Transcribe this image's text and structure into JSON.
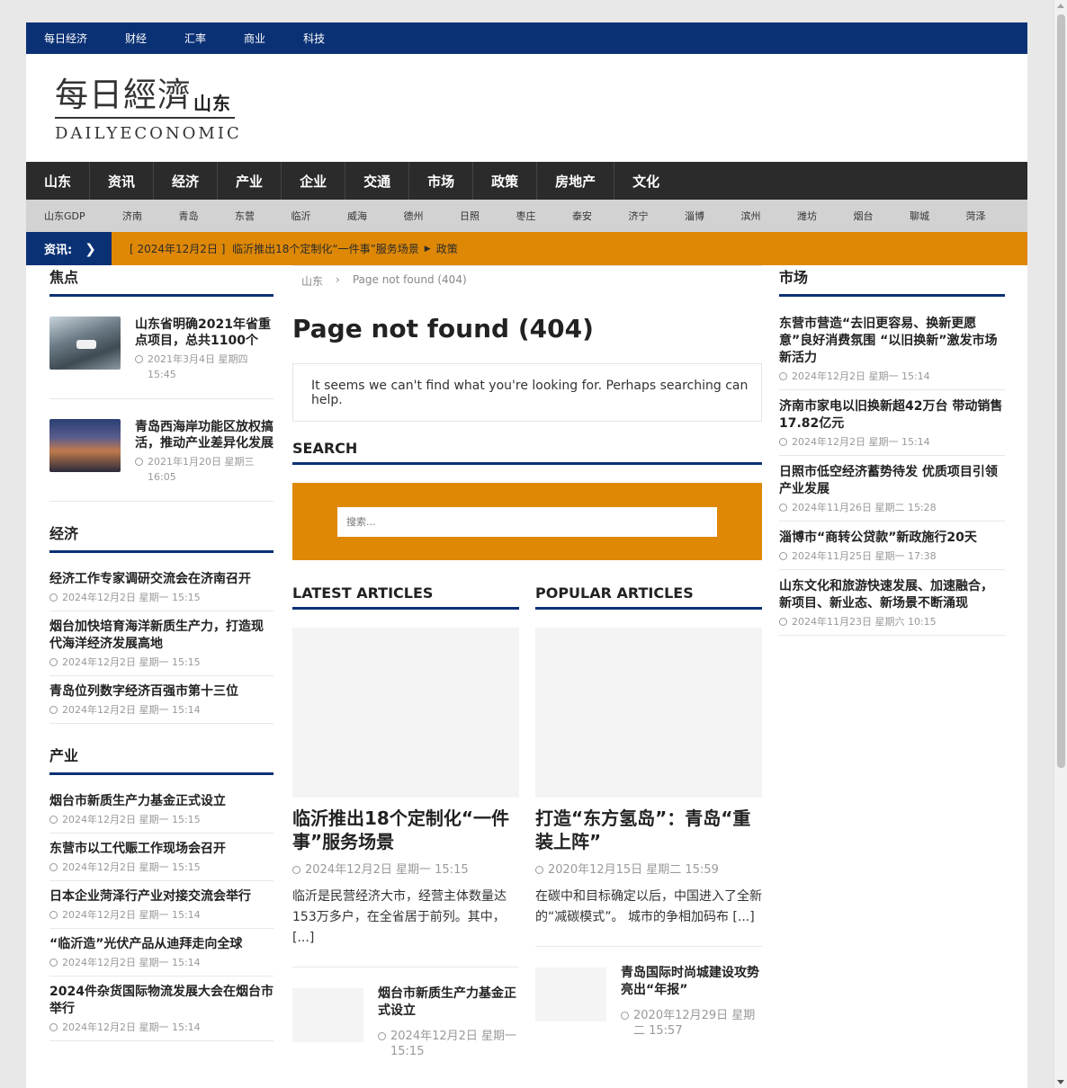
{
  "topbar": {
    "links": [
      "每日经济",
      "财经",
      "汇率",
      "商业",
      "科技"
    ]
  },
  "logo": {
    "cn": "每日經濟",
    "sub": "山东",
    "en": "DAILYECONOMIC"
  },
  "mainnav": [
    "山东",
    "资讯",
    "经济",
    "产业",
    "企业",
    "交通",
    "市场",
    "政策",
    "房地产",
    "文化"
  ],
  "subnav": [
    "山东GDP",
    "济南",
    "青岛",
    "东营",
    "临沂",
    "威海",
    "德州",
    "日照",
    "枣庄",
    "泰安",
    "济宁",
    "淄博",
    "滨州",
    "潍坊",
    "烟台",
    "聊城",
    "菏泽"
  ],
  "ticker": {
    "label": "资讯:",
    "date": "[ 2024年12月2日 ]",
    "headline": "临沂推出18个定制化“一件事”服务场景",
    "category": "政策"
  },
  "left": {
    "focus": {
      "title": "焦点",
      "items": [
        {
          "title": "山东省明确2021年省重点项目，总共1100个",
          "date": "2021年3月4日 星期四 15:45"
        },
        {
          "title": "青岛西海岸功能区放权搞活，推动产业差异化发展",
          "date": "2021年1月20日 星期三 16:05"
        }
      ]
    },
    "economy": {
      "title": "经济",
      "items": [
        {
          "title": "经济工作专家调研交流会在济南召开",
          "date": "2024年12月2日 星期一 15:15"
        },
        {
          "title": "烟台加快培育海洋新质生产力，打造现代海洋经济发展高地",
          "date": "2024年12月2日 星期一 15:15"
        },
        {
          "title": "青岛位列数字经济百强市第十三位",
          "date": "2024年12月2日 星期一 15:14"
        }
      ]
    },
    "industry": {
      "title": "产业",
      "items": [
        {
          "title": "烟台市新质生产力基金正式设立",
          "date": "2024年12月2日 星期一 15:15"
        },
        {
          "title": "东营市以工代赈工作现场会召开",
          "date": "2024年12月2日 星期一 15:15"
        },
        {
          "title": "日本企业菏泽行产业对接交流会举行",
          "date": "2024年12月2日 星期一 15:14"
        },
        {
          "title": "“临沂造”光伏产品从迪拜走向全球",
          "date": "2024年12月2日 星期一 15:14"
        },
        {
          "title": "2024件杂货国际物流发展大会在烟台市举行",
          "date": "2024年12月2日 星期一 15:14"
        }
      ]
    }
  },
  "main": {
    "breadcrumb": {
      "home": "山东",
      "sep": "›",
      "current": "Page not found (404)"
    },
    "heading": "Page not found (404)",
    "message": "It seems we can't find what you're looking for. Perhaps searching can help.",
    "search": {
      "title": "SEARCH",
      "placeholder": "搜索..."
    },
    "latest": {
      "title": "LATEST ARTICLES",
      "feature": {
        "title": "临沂推出18个定制化“一件事”服务场景",
        "date": "2024年12月2日 星期一 15:15",
        "excerpt": "临沂是民营经济大市，经营主体数量达153万多户，在全省居于前列。其中， [...]"
      },
      "small": {
        "title": "烟台市新质生产力基金正式设立",
        "date": "2024年12月2日 星期一 15:15"
      }
    },
    "popular": {
      "title": "POPULAR ARTICLES",
      "feature": {
        "title": "打造“东方氢岛”：青岛“重装上阵”",
        "date": "2020年12月15日 星期二 15:59",
        "excerpt": "在碳中和目标确定以后，中国进入了全新的“减碳模式”。 城市的争相加码布 [...]"
      },
      "small": {
        "title": "青岛国际时尚城建设攻势亮出“年报”",
        "date": "2020年12月29日 星期二 15:57"
      }
    }
  },
  "right": {
    "market": {
      "title": "市场",
      "items": [
        {
          "title": "东营市营造“去旧更容易、换新更愿意”良好消费氛围 “以旧换新”激发市场新活力",
          "date": "2024年12月2日 星期一 15:14"
        },
        {
          "title": "济南市家电以旧换新超42万台 带动销售17.82亿元",
          "date": "2024年12月2日 星期一 15:14"
        },
        {
          "title": "日照市低空经济蓄势待发 优质项目引领产业发展",
          "date": "2024年11月26日 星期二 15:28"
        },
        {
          "title": "淄博市“商转公贷款”新政施行20天",
          "date": "2024年11月25日 星期一 17:38"
        },
        {
          "title": "山东文化和旅游快速发展、加速融合，新项目、新业态、新场景不断涌现",
          "date": "2024年11月23日 星期六 10:15"
        }
      ]
    }
  },
  "colors": {
    "brand_blue": "#0b3175",
    "accent_orange": "#de8806",
    "nav_dark": "#2b2b2b"
  }
}
